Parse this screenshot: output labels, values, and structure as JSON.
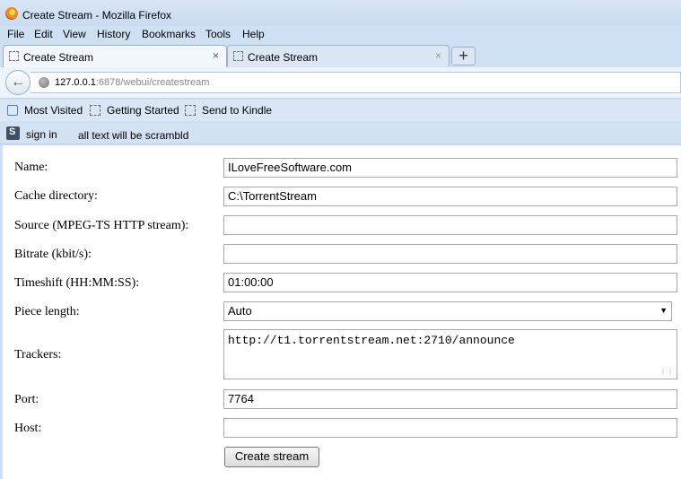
{
  "window": {
    "title": "Create Stream - Mozilla Firefox"
  },
  "menu": [
    "File",
    "Edit",
    "View",
    "History",
    "Bookmarks",
    "Tools",
    "Help"
  ],
  "tabs": [
    {
      "label": "Create Stream",
      "close": "×"
    },
    {
      "label": "Create Stream",
      "close": "×"
    }
  ],
  "new_tab": "+",
  "nav": {
    "back": "←",
    "url_host": "127.0.0.1",
    "url_path": ":6878/webui/createstream"
  },
  "bookmarks": [
    "Most Visited",
    "Getting Started",
    "Send to Kindle"
  ],
  "signbar": {
    "sign_in": "sign in",
    "note": "all text will be scrambld"
  },
  "form": {
    "name_label": "Name:",
    "name_value": "ILoveFreeSoftware.com",
    "cache_label": "Cache directory:",
    "cache_value": "C:\\TorrentStream",
    "source_label": "Source (MPEG-TS HTTP stream):",
    "source_value": "",
    "bitrate_label": "Bitrate (kbit/s):",
    "bitrate_value": "",
    "timeshift_label": "Timeshift (HH:MM:SS):",
    "timeshift_value": "01:00:00",
    "piece_label": "Piece length:",
    "piece_value": "Auto",
    "trackers_label": "Trackers:",
    "trackers_value": "http://t1.torrentstream.net:2710/announce",
    "port_label": "Port:",
    "port_value": "7764",
    "host_label": "Host:",
    "host_value": "",
    "submit_label": "Create stream"
  }
}
